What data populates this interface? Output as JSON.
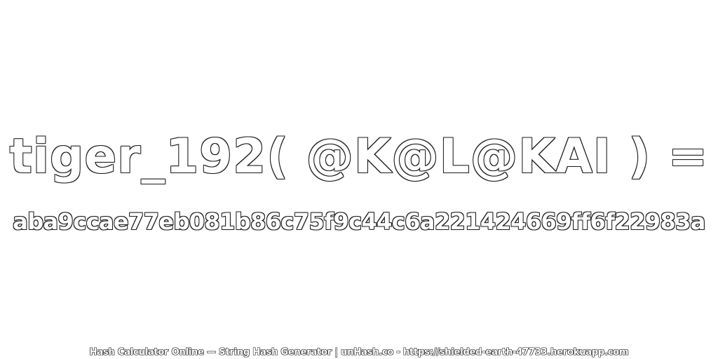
{
  "heading": "tiger_192( @K@L@KAI ) =",
  "hash_value": "aba9ccae77eb081b86c75f9c44c6a221424669ff6f22983a",
  "footer": "Hash Calculator Online — String Hash Generator | unHash.co - https://shielded-earth-47733.herokuapp.com",
  "colors": {
    "background": "#ffffff",
    "text_fill": "#ffffff",
    "text_outline": "#1a1a1a"
  }
}
